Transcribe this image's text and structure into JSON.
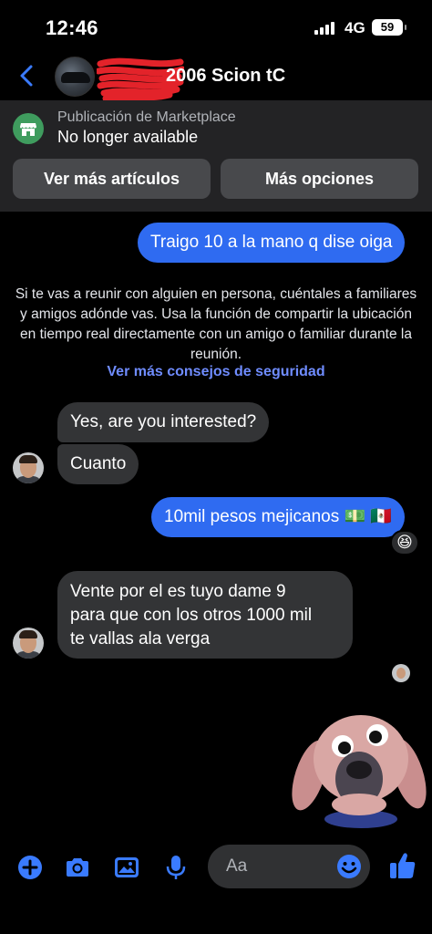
{
  "status_bar": {
    "time": "12:46",
    "network": "4G",
    "battery": "59"
  },
  "header": {
    "title": "2006 Scion tC"
  },
  "marketplace": {
    "label": "Publicación de Marketplace",
    "status": "No longer available",
    "buttons": [
      "Ver más artículos",
      "Más opciones"
    ]
  },
  "messages": [
    {
      "from": "me",
      "text": "Traigo 10 a la mano q dise oiga"
    },
    {
      "from": "them",
      "text": "Yes, are you interested?"
    },
    {
      "from": "them",
      "text": "Cuanto"
    },
    {
      "from": "me",
      "text": "10mil pesos mejicanos 💵 🇲🇽",
      "reaction": "😆"
    },
    {
      "from": "them",
      "lines": [
        "Vente por el es tuyo dame 9",
        "para que con los otros 1000 mil",
        "te vallas ala verga"
      ]
    }
  ],
  "safety_notice": {
    "text": "Si te vas a reunir con alguien en persona, cuéntales a familiares y amigos adónde vas. Usa la función de compartir la ubicación en tiempo real directamente con un amigo o familiar durante la reunión.",
    "link": "Ver más consejos de seguridad"
  },
  "composer": {
    "placeholder": "Aa"
  },
  "colors": {
    "accent": "#2f6bf1",
    "link": "#6f8cff",
    "incoming_bubble": "#333436",
    "marketplace_green": "#3f9c5e"
  },
  "icons": [
    "back-icon",
    "marketplace-store-icon",
    "plus-icon",
    "camera-icon",
    "image-icon",
    "microphone-icon",
    "emoji-icon",
    "thumbs-up-icon"
  ]
}
